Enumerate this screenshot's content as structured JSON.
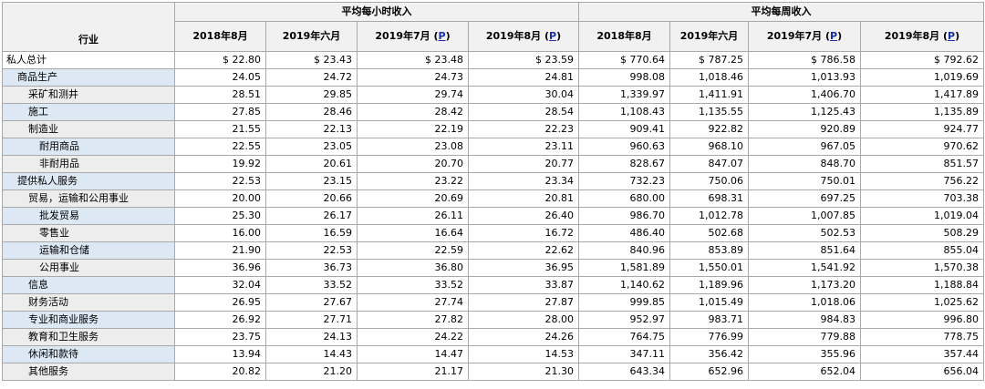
{
  "header": {
    "industry_label": "行业",
    "group_hourly": "平均每小时收入",
    "group_weekly": "平均每周收入",
    "columns": [
      {
        "label": "2018年8月",
        "p": ""
      },
      {
        "label": "2019年六月",
        "p": ""
      },
      {
        "label": "2019年7月",
        "p": "P"
      },
      {
        "label": "2019年8月",
        "p": "P"
      }
    ]
  },
  "rows": [
    {
      "label": "私人总计",
      "level": 0,
      "style": "total",
      "hourly": [
        "$ 22.80",
        "$ 23.43",
        "$ 23.48",
        "$ 23.59"
      ],
      "weekly": [
        "$ 770.64",
        "$ 787.25",
        "$ 786.58",
        "$ 792.62"
      ]
    },
    {
      "label": "商品生产",
      "level": 1,
      "style": "band",
      "hourly": [
        "24.05",
        "24.72",
        "24.73",
        "24.81"
      ],
      "weekly": [
        "998.08",
        "1,018.46",
        "1,013.93",
        "1,019.69"
      ]
    },
    {
      "label": "采矿和测井",
      "level": 2,
      "style": "plain",
      "hourly": [
        "28.51",
        "29.85",
        "29.74",
        "30.04"
      ],
      "weekly": [
        "1,339.97",
        "1,411.91",
        "1,406.70",
        "1,417.89"
      ]
    },
    {
      "label": "施工",
      "level": 2,
      "style": "band",
      "hourly": [
        "27.85",
        "28.46",
        "28.42",
        "28.54"
      ],
      "weekly": [
        "1,108.43",
        "1,135.55",
        "1,125.43",
        "1,135.89"
      ]
    },
    {
      "label": "制造业",
      "level": 2,
      "style": "plain",
      "hourly": [
        "21.55",
        "22.13",
        "22.19",
        "22.23"
      ],
      "weekly": [
        "909.41",
        "922.82",
        "920.89",
        "924.77"
      ]
    },
    {
      "label": "耐用商品",
      "level": 3,
      "style": "band",
      "hourly": [
        "22.55",
        "23.05",
        "23.08",
        "23.11"
      ],
      "weekly": [
        "960.63",
        "968.10",
        "967.05",
        "970.62"
      ]
    },
    {
      "label": "非耐用品",
      "level": 3,
      "style": "plain",
      "hourly": [
        "19.92",
        "20.61",
        "20.70",
        "20.77"
      ],
      "weekly": [
        "828.67",
        "847.07",
        "848.70",
        "851.57"
      ]
    },
    {
      "label": "提供私人服务",
      "level": 1,
      "style": "band",
      "hourly": [
        "22.53",
        "23.15",
        "23.22",
        "23.34"
      ],
      "weekly": [
        "732.23",
        "750.06",
        "750.01",
        "756.22"
      ]
    },
    {
      "label": "贸易，运输和公用事业",
      "level": 2,
      "style": "plain",
      "hourly": [
        "20.00",
        "20.66",
        "20.69",
        "20.81"
      ],
      "weekly": [
        "680.00",
        "698.31",
        "697.25",
        "703.38"
      ]
    },
    {
      "label": "批发贸易",
      "level": 3,
      "style": "band",
      "hourly": [
        "25.30",
        "26.17",
        "26.11",
        "26.40"
      ],
      "weekly": [
        "986.70",
        "1,012.78",
        "1,007.85",
        "1,019.04"
      ]
    },
    {
      "label": "零售业",
      "level": 3,
      "style": "plain",
      "hourly": [
        "16.00",
        "16.59",
        "16.64",
        "16.72"
      ],
      "weekly": [
        "486.40",
        "502.68",
        "502.53",
        "508.29"
      ]
    },
    {
      "label": "运输和仓储",
      "level": 3,
      "style": "band",
      "hourly": [
        "21.90",
        "22.53",
        "22.59",
        "22.62"
      ],
      "weekly": [
        "840.96",
        "853.89",
        "851.64",
        "855.04"
      ]
    },
    {
      "label": "公用事业",
      "level": 3,
      "style": "plain",
      "hourly": [
        "36.96",
        "36.73",
        "36.80",
        "36.95"
      ],
      "weekly": [
        "1,581.89",
        "1,550.01",
        "1,541.92",
        "1,570.38"
      ]
    },
    {
      "label": "信息",
      "level": 2,
      "style": "band",
      "hourly": [
        "32.04",
        "33.52",
        "33.52",
        "33.87"
      ],
      "weekly": [
        "1,140.62",
        "1,189.96",
        "1,173.20",
        "1,188.84"
      ]
    },
    {
      "label": "财务活动",
      "level": 2,
      "style": "plain",
      "hourly": [
        "26.95",
        "27.67",
        "27.74",
        "27.87"
      ],
      "weekly": [
        "999.85",
        "1,015.49",
        "1,018.06",
        "1,025.62"
      ]
    },
    {
      "label": "专业和商业服务",
      "level": 2,
      "style": "band",
      "hourly": [
        "26.92",
        "27.71",
        "27.82",
        "28.00"
      ],
      "weekly": [
        "952.97",
        "983.71",
        "984.83",
        "996.80"
      ]
    },
    {
      "label": "教育和卫生服务",
      "level": 2,
      "style": "plain",
      "hourly": [
        "23.75",
        "24.13",
        "24.22",
        "24.26"
      ],
      "weekly": [
        "764.75",
        "776.99",
        "779.88",
        "778.75"
      ]
    },
    {
      "label": "休闲和款待",
      "level": 2,
      "style": "band",
      "hourly": [
        "13.94",
        "14.43",
        "14.47",
        "14.53"
      ],
      "weekly": [
        "347.11",
        "356.42",
        "355.96",
        "357.44"
      ]
    },
    {
      "label": "其他服务",
      "level": 2,
      "style": "plain",
      "hourly": [
        "20.82",
        "21.20",
        "21.17",
        "21.30"
      ],
      "weekly": [
        "643.34",
        "652.96",
        "652.04",
        "656.04"
      ]
    }
  ]
}
